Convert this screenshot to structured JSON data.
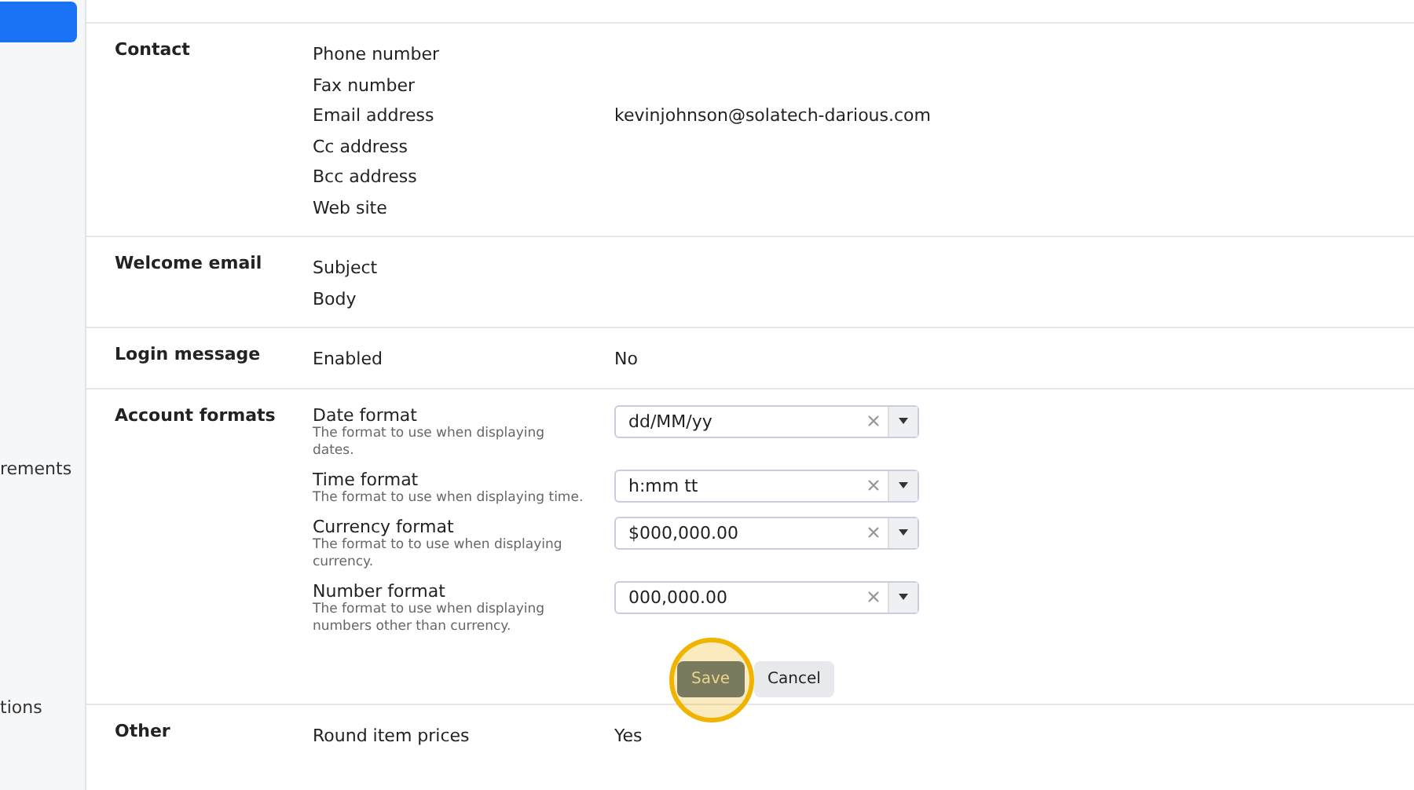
{
  "sidebar": {
    "items": [
      {
        "label": "rements"
      },
      {
        "label": "tions"
      }
    ]
  },
  "sections": [
    {
      "title": "Contact",
      "rows": [
        {
          "label": "Phone number"
        },
        {
          "label": "Fax number"
        },
        {
          "label": "Email address",
          "value": "kevinjohnson@solatech-darious.com"
        },
        {
          "label": "Cc address"
        },
        {
          "label": "Bcc address"
        },
        {
          "label": "Web site"
        }
      ]
    },
    {
      "title": "Welcome email",
      "rows": [
        {
          "label": "Subject"
        },
        {
          "label": "Body"
        }
      ]
    },
    {
      "title": "Login message",
      "rows": [
        {
          "label": "Enabled",
          "value": "No"
        }
      ]
    },
    {
      "title": "Account formats",
      "formats": [
        {
          "label": "Date format",
          "help": "The format to use when displaying dates.",
          "value": "dd/MM/yy"
        },
        {
          "label": "Time format",
          "help": "The format to use when displaying time.",
          "value": "h:mm tt"
        },
        {
          "label": "Currency format",
          "help": "The format to to use when displaying currency.",
          "value": "$000,000.00"
        },
        {
          "label": "Number format",
          "help": "The format to use when displaying numbers other than currency.",
          "value": "000,000.00"
        }
      ],
      "buttons": [
        {
          "label": "Save",
          "kind": "primary",
          "highlighted": true
        },
        {
          "label": "Cancel",
          "kind": "secondary",
          "highlighted": false
        }
      ]
    },
    {
      "title": "Other",
      "rows": [
        {
          "label": "Round item prices",
          "value": "Yes"
        }
      ]
    }
  ]
}
